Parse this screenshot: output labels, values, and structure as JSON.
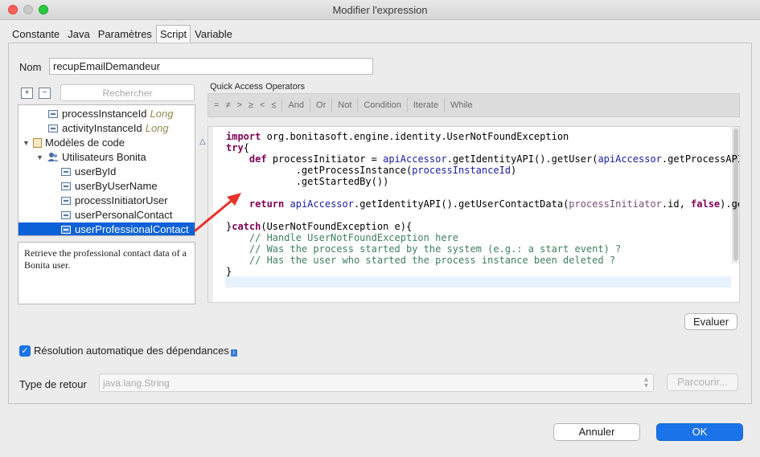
{
  "window": {
    "title": "Modifier l'expression"
  },
  "tabs": [
    {
      "label": "Constante"
    },
    {
      "label": "Java"
    },
    {
      "label": "Paramètres"
    },
    {
      "label": "Script",
      "active": true
    },
    {
      "label": "Variable"
    }
  ],
  "name": {
    "label": "Nom",
    "value": "recupEmailDemandeur"
  },
  "search": {
    "placeholder": "Rechercher"
  },
  "tree": {
    "items": [
      {
        "label": "processInstanceId",
        "type": "Long"
      },
      {
        "label": "activityInstanceId",
        "type": "Long"
      },
      {
        "label": "Modèles de code"
      },
      {
        "label": "Utilisateurs Bonita"
      },
      {
        "label": "userById"
      },
      {
        "label": "userByUserName"
      },
      {
        "label": "processInitiatorUser"
      },
      {
        "label": "userPersonalContact"
      },
      {
        "label": "userProfessionalContact",
        "selected": true
      }
    ]
  },
  "description": "Retrieve the professional contact data of a Bonita user.",
  "quick_access": {
    "label": "Quick Access Operators",
    "operators": [
      "=",
      "≠",
      ">",
      "≥",
      "<",
      "≤"
    ],
    "keywords": [
      "And",
      "Or",
      "Not",
      "Condition",
      "Iterate",
      "While"
    ]
  },
  "code": {
    "line1": "org.bonitasoft.engine.identity.UserNotFoundException",
    "line3_var": "processInitiator",
    "line3_call": "apiAccessor",
    "line3_rest": ".getIdentityAPI().getUser(",
    "line3_call2": "apiAccessor",
    "line3_rest2": ".getProcessAPI()",
    "line4_rest": ".getProcessInstance(",
    "line4_par": "processInstanceId",
    "line5": ".getStartedBy())",
    "line7_call": "apiAccessor",
    "line7_rest": ".getIdentityAPI().getUserContactData(",
    "line7_par": "processInitiator",
    "line7_rest2": ".id, ",
    "line7_rest3": ").getEmail()",
    "line9_rest": "(UserNotFoundException e){",
    "comment1": "// Handle UserNotFoundException here",
    "comment2": "// Was the process started by the system (e.g.: a start event) ?",
    "comment3": "// Has the user who started the process instance been deleted ?"
  },
  "buttons": {
    "evaluate": "Evaluer",
    "browse": "Parcourir...",
    "cancel": "Annuler",
    "ok": "OK"
  },
  "dependency": {
    "label": "Résolution automatique des dépendances",
    "checked": true
  },
  "return_type": {
    "label": "Type de retour",
    "value": "java.lang.String"
  },
  "colors": {
    "accent": "#1a73e8",
    "selection": "#0b61d8",
    "arrow": "#e8332a"
  }
}
